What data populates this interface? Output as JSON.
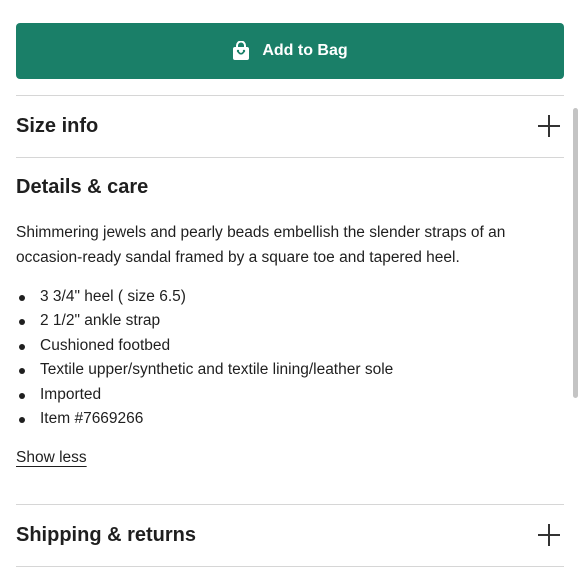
{
  "add_to_bag": {
    "label": "Add to Bag",
    "icon": "shopping-bag-icon"
  },
  "size_info": {
    "title": "Size info",
    "icon": "plus-icon"
  },
  "details_care": {
    "title": "Details & care",
    "description": "Shimmering jewels and pearly beads embellish the slender straps of an occasion-ready sandal framed by a square toe and tapered heel.",
    "bullets": [
      "3 3/4\" heel ( size 6.5)",
      "2 1/2\" ankle strap",
      "Cushioned footbed",
      "Textile upper/synthetic and textile lining/leather sole",
      "Imported",
      "Item #7669266"
    ],
    "show_less": "Show less"
  },
  "shipping_returns": {
    "title": "Shipping & returns",
    "icon": "plus-icon"
  },
  "colors": {
    "accent": "#1a7f68",
    "divider": "#d6d6d6"
  }
}
